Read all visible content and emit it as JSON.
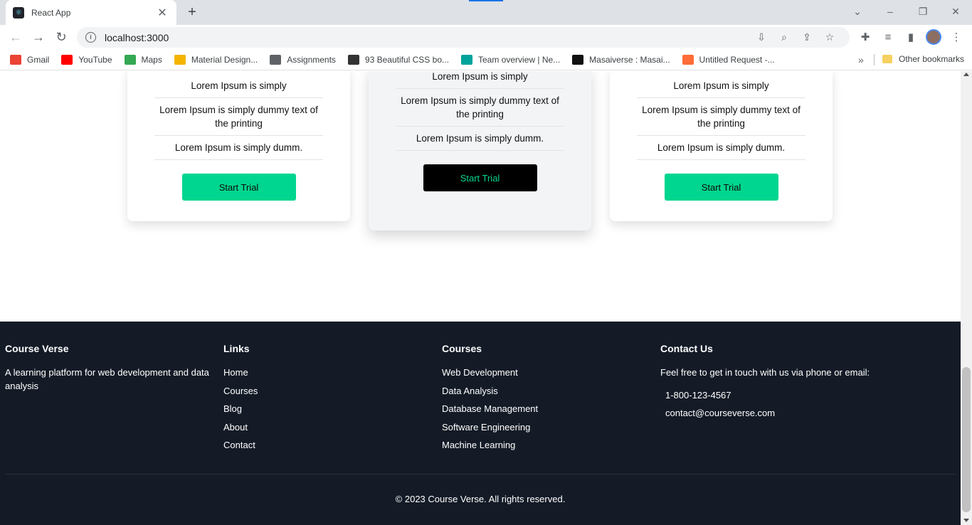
{
  "browser": {
    "tab_title": "React App",
    "url": "localhost:3000",
    "bookmarks": [
      {
        "label": "Gmail",
        "icon": "gmail-icon",
        "color": "#ea4335"
      },
      {
        "label": "YouTube",
        "icon": "youtube-icon",
        "color": "#ff0000"
      },
      {
        "label": "Maps",
        "icon": "maps-icon",
        "color": "#34a853"
      },
      {
        "label": "Material Design...",
        "icon": "material-design-icon",
        "color": "#f4b400"
      },
      {
        "label": "Assignments",
        "icon": "assignments-icon",
        "color": "#5f6368"
      },
      {
        "label": "93 Beautiful CSS bo...",
        "icon": "css-icon",
        "color": "#333333"
      },
      {
        "label": "Team overview | Ne...",
        "icon": "team-overview-icon",
        "color": "#00a39b"
      },
      {
        "label": "Masaiverse : Masai...",
        "icon": "masaiverse-icon",
        "color": "#111111"
      },
      {
        "label": "Untitled Request -...",
        "icon": "postman-icon",
        "color": "#ff6c37"
      }
    ],
    "other_bookmarks": "Other bookmarks"
  },
  "pricing": {
    "cards": [
      {
        "features": [
          "Lorem Ipsum is simply",
          "Lorem Ipsum is simply dummy text of the printing",
          "Lorem Ipsum is simply dumm."
        ],
        "button": "Start Trial"
      },
      {
        "features": [
          "Lorem Ipsum is simply",
          "Lorem Ipsum is simply dummy text of the printing",
          "Lorem Ipsum is simply dumm."
        ],
        "button": "Start Trial"
      },
      {
        "features": [
          "Lorem Ipsum is simply",
          "Lorem Ipsum is simply dummy text of the printing",
          "Lorem Ipsum is simply dumm."
        ],
        "button": "Start Trial"
      }
    ]
  },
  "footer": {
    "brand": {
      "title": "Course Verse",
      "description": "A learning platform for web development and data analysis"
    },
    "links": {
      "title": "Links",
      "items": [
        "Home",
        "Courses",
        "Blog",
        "About",
        "Contact"
      ]
    },
    "courses": {
      "title": "Courses",
      "items": [
        "Web Development",
        "Data Analysis",
        "Database Management",
        "Software Engineering",
        "Machine Learning"
      ]
    },
    "contact": {
      "title": "Contact Us",
      "intro": "Feel free to get in touch with us via phone or email:",
      "phone": "1-800-123-4567",
      "email": "contact@courseverse.com"
    },
    "copyright": "© 2023 Course Verse. All rights reserved."
  },
  "colors": {
    "accent": "#00d68f",
    "footer_bg": "#141b27",
    "featured_bg": "#f3f4f6"
  }
}
